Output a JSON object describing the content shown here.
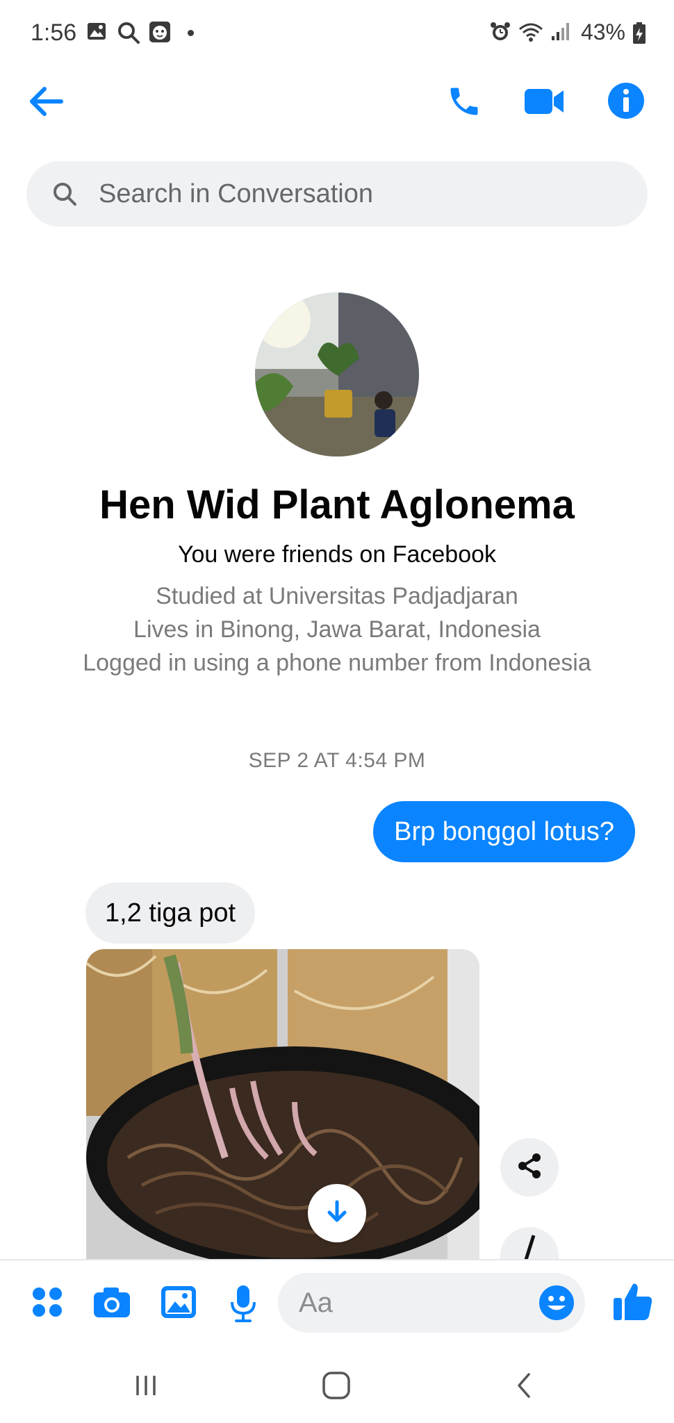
{
  "status_bar": {
    "time": "1:56",
    "battery": "43%",
    "icons": [
      "gallery-icon",
      "search-icon",
      "tiger-app-icon",
      "dot-icon",
      "alarm-icon",
      "wifi-icon",
      "signal-icon",
      "battery-charging-icon"
    ]
  },
  "header": {
    "icons": [
      "back-arrow-icon",
      "phone-icon",
      "video-camera-icon",
      "info-icon"
    ]
  },
  "search": {
    "placeholder": "Search in Conversation"
  },
  "profile": {
    "name": "Hen Wid Plant Aglonema",
    "friend_status": "You were friends on Facebook",
    "details": [
      "Studied at Universitas Padjadjaran",
      "Lives in Binong, Jawa Barat, Indonesia",
      "Logged in using a phone number from Indonesia"
    ]
  },
  "conversation": {
    "timestamp": "SEP 2 AT 4:54 PM",
    "messages": [
      {
        "direction": "sent",
        "text": "Brp bonggol lotus?"
      },
      {
        "direction": "received",
        "text": "1,2 tiga pot"
      }
    ]
  },
  "composer": {
    "placeholder": "Aa",
    "icons": [
      "apps-grid-icon",
      "camera-icon",
      "image-icon",
      "microphone-icon",
      "emoji-icon",
      "thumbs-up-icon"
    ]
  },
  "colors": {
    "accent": "#0a84ff",
    "sent_bubble": "#0a84ff",
    "received_bubble": "#eeeff1",
    "search_bg": "#f0f1f3",
    "secondary_text": "#7a7a7a"
  }
}
